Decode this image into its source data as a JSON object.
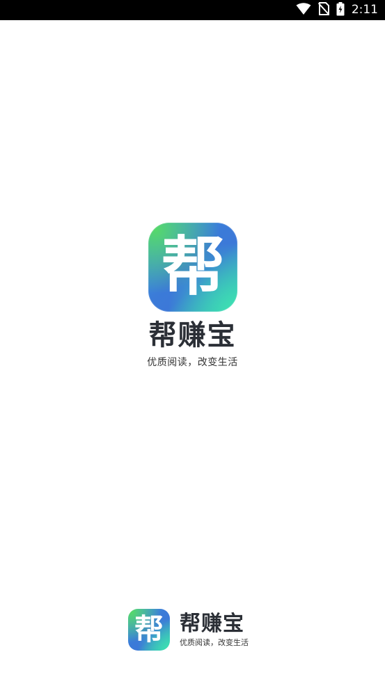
{
  "status_bar": {
    "time": "2:11",
    "icons": [
      "wifi-icon",
      "no-sim-icon",
      "battery-charging-icon"
    ]
  },
  "splash": {
    "icon_glyph": "帮",
    "app_name": "帮赚宝",
    "slogan": "优质阅读，改变生活"
  },
  "bottom_brand": {
    "icon_glyph": "帮",
    "app_name": "帮赚宝",
    "slogan": "优质阅读，改变生活"
  },
  "colors": {
    "background": "#ffffff",
    "status_bar": "#000000",
    "title_text": "#2b2f36",
    "icon_gradient_green": "#56d86a",
    "icon_gradient_blue": "#3c78d8",
    "icon_gradient_teal": "#3ee2b2"
  }
}
